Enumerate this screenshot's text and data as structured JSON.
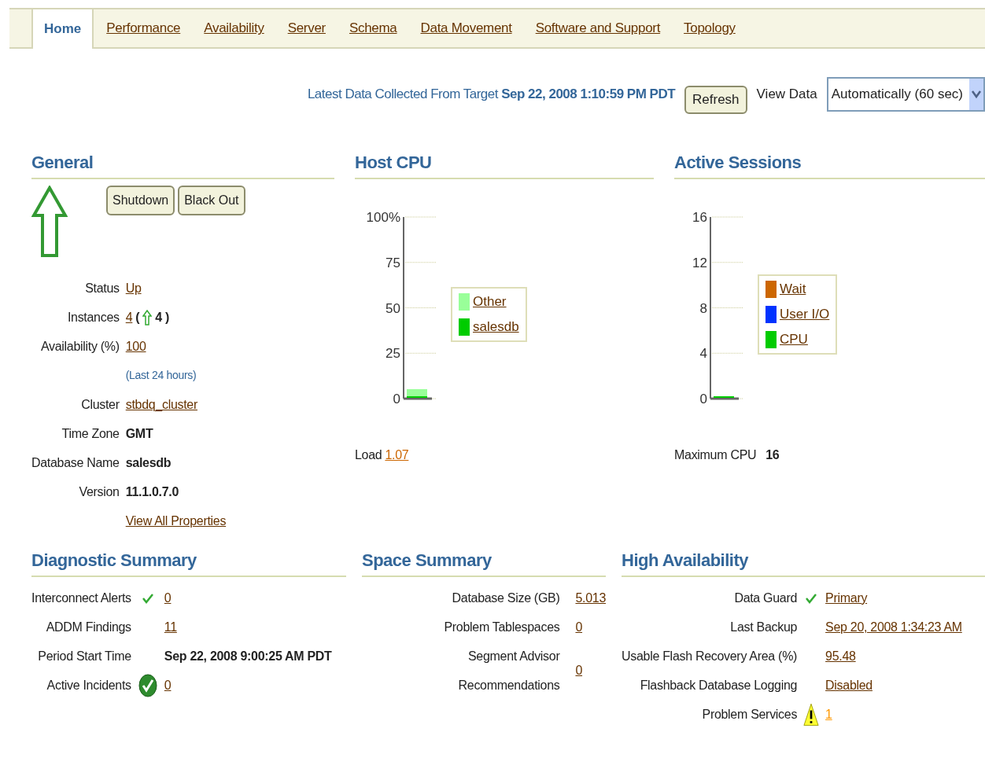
{
  "tabs": [
    {
      "label": "Home",
      "selected": true
    },
    {
      "label": "Performance",
      "selected": false
    },
    {
      "label": "Availability",
      "selected": false
    },
    {
      "label": "Server",
      "selected": false
    },
    {
      "label": "Schema",
      "selected": false
    },
    {
      "label": "Data Movement",
      "selected": false
    },
    {
      "label": "Software and Support",
      "selected": false
    },
    {
      "label": "Topology",
      "selected": false
    }
  ],
  "refresh_bar": {
    "collected_label": "Latest Data Collected From Target",
    "timestamp": "Sep 22, 2008 1:10:59 PM PDT",
    "refresh_button": "Refresh",
    "view_label": "View Data",
    "view_value": "Automatically (60 sec)"
  },
  "general": {
    "title": "General",
    "buttons": [
      "Shutdown",
      "Black Out"
    ],
    "rows": [
      {
        "kind": "link",
        "label": "Status",
        "value": "Up"
      },
      {
        "kind": "instances",
        "label": "Instances",
        "value": "4",
        "open": "(",
        "up_count": "4",
        "close": ")"
      },
      {
        "kind": "link",
        "label": "Availability (%)",
        "value": "100"
      },
      {
        "kind": "note",
        "value": "(Last 24 hours)"
      },
      {
        "kind": "link",
        "label": "Cluster",
        "value": "stbdq_cluster"
      },
      {
        "kind": "bold",
        "label": "Time Zone",
        "value": "GMT"
      },
      {
        "kind": "bold",
        "label": "Database Name",
        "value": "salesdb"
      },
      {
        "kind": "bold",
        "label": "Version",
        "value": "11.1.0.7.0"
      },
      {
        "kind": "link",
        "value": "View All Properties"
      }
    ]
  },
  "host_cpu": {
    "title": "Host CPU",
    "axis_labels": [
      "100%",
      "75",
      "50",
      "25",
      "0"
    ],
    "legend": [
      {
        "label": "Other",
        "color": "#99ff99"
      },
      {
        "label": "salesdb",
        "color": "#00cc00"
      }
    ],
    "load_label": "Load",
    "load_value": "1.07"
  },
  "active_sessions": {
    "title": "Active Sessions",
    "axis_labels": [
      "16",
      "12",
      "8",
      "4",
      "0"
    ],
    "legend": [
      {
        "label": "Wait",
        "color": "#cc6600"
      },
      {
        "label": "User I/O",
        "color": "#0033ff"
      },
      {
        "label": "CPU",
        "color": "#00cc00"
      }
    ],
    "max_cpu_label": "Maximum CPU",
    "max_cpu_value": "16"
  },
  "diagnostic_summary": {
    "title": "Diagnostic Summary",
    "rows": [
      {
        "label": "Interconnect Alerts",
        "ok": true,
        "circled": false,
        "kind": "link",
        "value": "0"
      },
      {
        "label": "ADDM Findings",
        "ok": false,
        "circled": false,
        "kind": "link",
        "value": "11"
      },
      {
        "label": "Period Start Time",
        "ok": false,
        "circled": false,
        "kind": "bold",
        "value": "Sep 22, 2008 9:00:25 AM PDT"
      },
      {
        "label": "Active Incidents",
        "ok": true,
        "circled": true,
        "kind": "link",
        "value": "0"
      }
    ]
  },
  "space_summary": {
    "title": "Space Summary",
    "rows": [
      {
        "label": "Database Size (GB)",
        "value": "5.013"
      },
      {
        "label": "Problem Tablespaces",
        "value": "0"
      },
      {
        "label": "Segment Advisor Recommendations",
        "value": "0"
      }
    ]
  },
  "high_availability": {
    "title": "High Availability",
    "rows": [
      {
        "label": "Data Guard",
        "ok": true,
        "warning": false,
        "value": "Primary"
      },
      {
        "label": "Last Backup",
        "ok": false,
        "warning": false,
        "value": "Sep 20, 2008 1:34:23 AM"
      },
      {
        "label": "Usable Flash Recovery Area (%)",
        "ok": false,
        "warning": false,
        "value": "95.48"
      },
      {
        "label": "Flashback Database Logging",
        "ok": false,
        "warning": false,
        "value": "Disabled"
      },
      {
        "label": "Problem Services",
        "ok": false,
        "warning": true,
        "value": "1"
      }
    ]
  }
}
